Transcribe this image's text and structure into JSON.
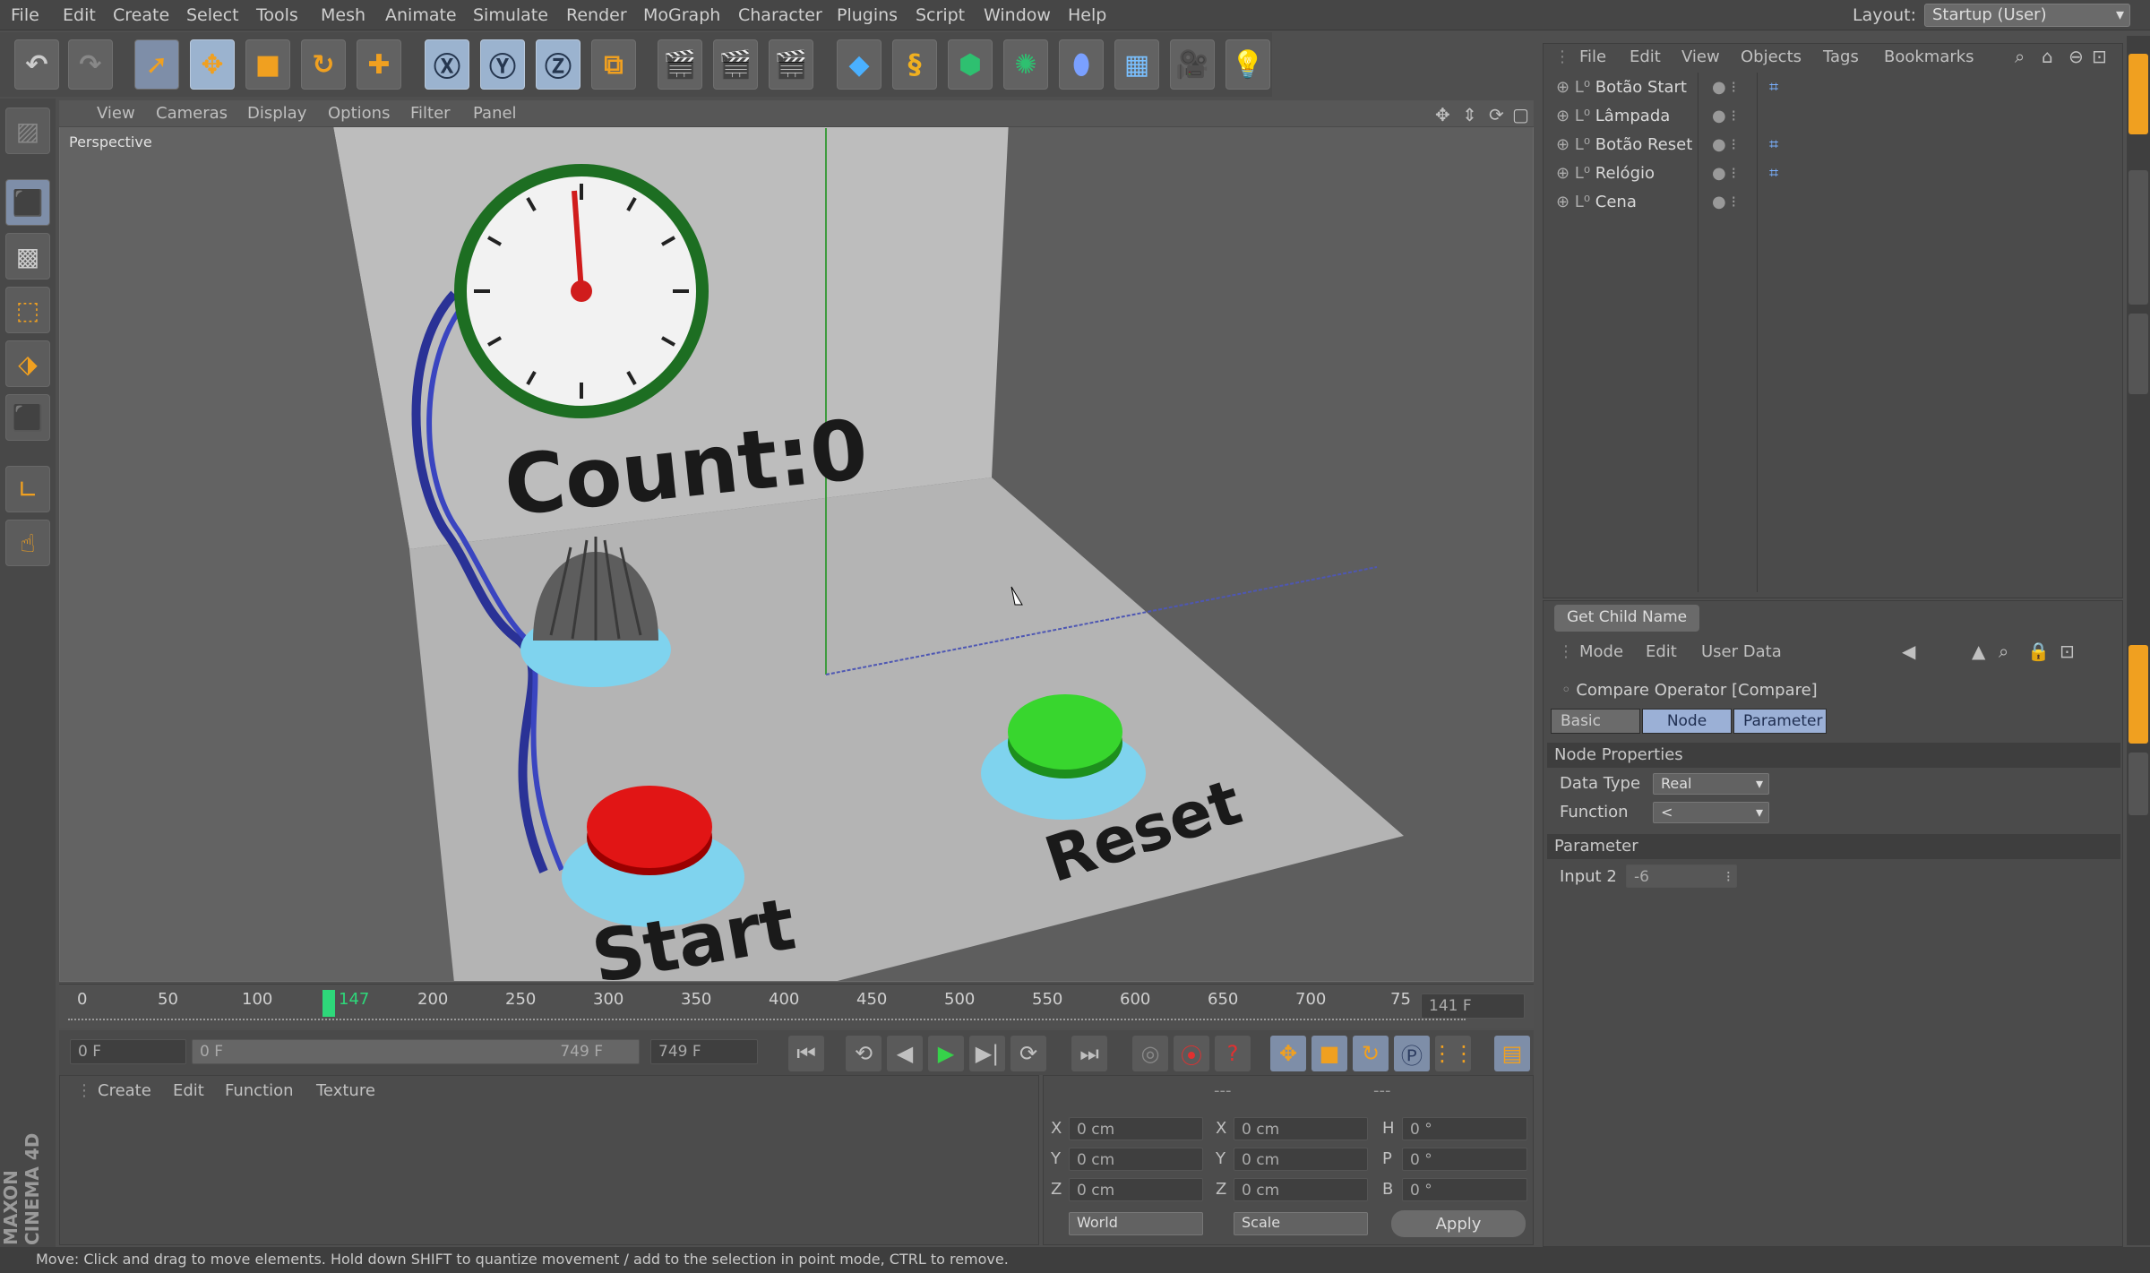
{
  "menubar": {
    "items": [
      "File",
      "Edit",
      "Create",
      "Select",
      "Tools",
      "Mesh",
      "Animate",
      "Simulate",
      "Render",
      "MoGraph",
      "Character",
      "Plugins",
      "Script",
      "Window",
      "Help"
    ],
    "layout_label": "Layout:",
    "layout_value": "Startup (User)"
  },
  "viewport": {
    "menu": [
      "View",
      "Cameras",
      "Display",
      "Options",
      "Filter",
      "Panel"
    ],
    "camera_label": "Perspective",
    "scene_text": {
      "count": "Count:0",
      "start": "Start",
      "reset": "Reset"
    }
  },
  "timeline": {
    "ticks": [
      "0",
      "50",
      "100",
      "147",
      "200",
      "250",
      "300",
      "350",
      "400",
      "450",
      "500",
      "550",
      "600",
      "650",
      "700",
      "75"
    ],
    "current_frame": "141 F",
    "start_field": "0 F",
    "range_start": "0 F",
    "range_end": "749 F",
    "end_field": "749 F"
  },
  "materials": {
    "menu": [
      "Create",
      "Edit",
      "Function",
      "Texture"
    ]
  },
  "coordinates": {
    "header": [
      "---",
      "---",
      "---"
    ],
    "rows": [
      {
        "a": "X",
        "av": "0 cm",
        "b": "X",
        "bv": "0 cm",
        "c": "H",
        "cv": "0 °"
      },
      {
        "a": "Y",
        "av": "0 cm",
        "b": "Y",
        "bv": "0 cm",
        "c": "P",
        "cv": "0 °"
      },
      {
        "a": "Z",
        "av": "0 cm",
        "b": "Z",
        "bv": "0 cm",
        "c": "B",
        "cv": "0 °"
      }
    ],
    "world": "World",
    "scale": "Scale",
    "apply": "Apply"
  },
  "object_manager": {
    "menu": [
      "File",
      "Edit",
      "View",
      "Objects",
      "Tags",
      "Bookmarks"
    ],
    "objects": [
      "Botão Start",
      "Lâmpada",
      "Botão Reset",
      "Relógio",
      "Cena"
    ]
  },
  "attribute_manager": {
    "node_title": "Get Child Name",
    "menu": [
      "Mode",
      "Edit",
      "User Data"
    ],
    "operator_title": "Compare Operator [Compare]",
    "tabs": [
      "Basic",
      "Node",
      "Parameter"
    ],
    "node_properties_label": "Node Properties",
    "data_type_label": "Data Type",
    "data_type_value": "Real",
    "function_label": "Function",
    "function_value": "<",
    "parameter_label": "Parameter",
    "input2_label": "Input 2",
    "input2_value": "-6"
  },
  "status": "Move: Click and drag to move elements. Hold down SHIFT to quantize movement / add to the selection in point mode, CTRL to remove.",
  "branding": "MAXON CINEMA 4D",
  "colors": {
    "accent": "#f0a020",
    "green_button": "#2ec22a",
    "red_button": "#d41010",
    "clock_ring": "#1e7a25"
  }
}
